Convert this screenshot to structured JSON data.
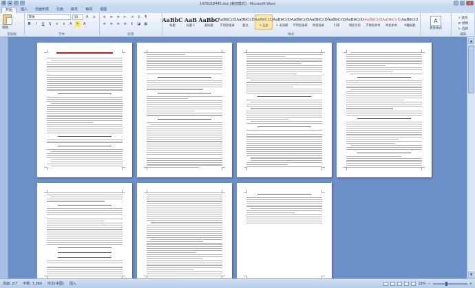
{
  "window": {
    "title": "1476018445.doc [兼容模式] - Microsoft Word",
    "qat_icons": [
      "word-logo-icon",
      "save-icon",
      "undo-icon",
      "redo-icon"
    ],
    "controls": {
      "minimize": "–",
      "maximize": "□",
      "close": "✕"
    }
  },
  "tabs": [
    {
      "label": "开始",
      "active": true
    },
    {
      "label": "插入"
    },
    {
      "label": "页面布局"
    },
    {
      "label": "引用"
    },
    {
      "label": "邮件"
    },
    {
      "label": "审阅"
    },
    {
      "label": "视图"
    }
  ],
  "ribbon": {
    "clipboard": {
      "paste_label": "粘贴",
      "group_label": "剪贴板"
    },
    "font": {
      "font_name": "宋体",
      "font_size": "10",
      "group_label": "字体"
    },
    "paragraph": {
      "group_label": "段落"
    },
    "styles": {
      "group_label": "样式",
      "items": [
        {
          "sample": "AaBbC",
          "name": "标题",
          "kind": "big"
        },
        {
          "sample": "AaB",
          "name": "标题 1",
          "kind": "big"
        },
        {
          "sample": "AaBbC",
          "name": "副标题",
          "kind": "big"
        },
        {
          "sample": "AaBbCcD",
          "name": "不明显强调",
          "kind": "normal"
        },
        {
          "sample": "AaBbCcD",
          "name": "要点",
          "kind": "normal"
        },
        {
          "sample": "AaBbCcD",
          "name": "+ 正文",
          "kind": "blue",
          "selected": true
        },
        {
          "sample": "AaBbCcD",
          "name": "+ 无间隔",
          "kind": "normal"
        },
        {
          "sample": "AaBbCcD",
          "name": "不明显强调",
          "kind": "normal"
        },
        {
          "sample": "AaBbCcD",
          "name": "明显强调",
          "kind": "normal"
        },
        {
          "sample": "AaBbCcD",
          "name": "引用",
          "kind": "normal"
        },
        {
          "sample": "AaBbCcD",
          "name": "明显引用",
          "kind": "normal"
        },
        {
          "sample": "AaBbCcD",
          "name": "不明显参考",
          "kind": "red"
        },
        {
          "sample": "AaBbCcD",
          "name": "明显参考",
          "kind": "red"
        },
        {
          "sample": "AaBbCcI",
          "name": "书籍标题",
          "kind": "normal"
        }
      ]
    },
    "change_styles": {
      "label": "更改样式"
    },
    "editing": {
      "find": "查找",
      "replace": "替换",
      "select": "选择",
      "group_label": "编辑"
    }
  },
  "status": {
    "page": "页面: 2/7",
    "words": "字数: 7,360",
    "lang": "中文(中国)",
    "mode": "插入",
    "zoom": "19%"
  }
}
